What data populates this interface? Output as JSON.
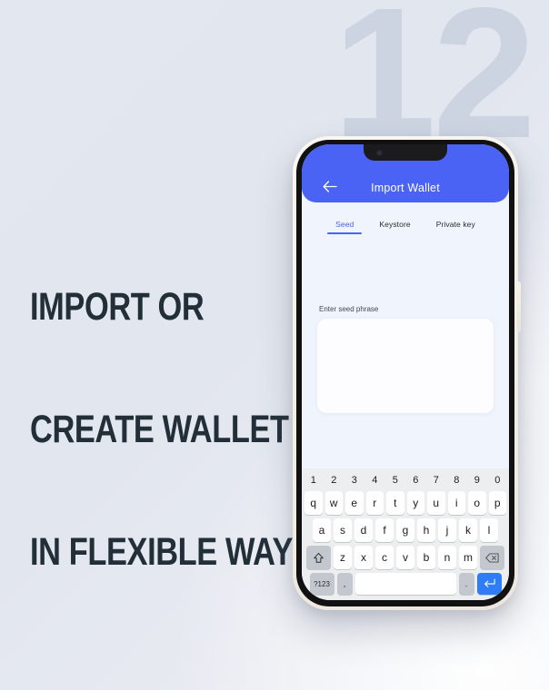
{
  "background": {
    "watermark_number": "12",
    "watermark_color": "#ccd3e0",
    "base_color": "#e2e6ee"
  },
  "headline": {
    "color": "#222e38",
    "lines": [
      "IMPORT OR",
      "CREATE WALLET",
      "IN FLEXIBLE WAYS"
    ]
  },
  "phone": {
    "frame_color": "#f4efe8",
    "bezel_color": "#111111",
    "screen_background": "#eff4fd",
    "side_button": "power-button"
  },
  "app": {
    "accent_color": "#4a63f5",
    "header": {
      "title": "Import Wallet",
      "back_icon": "arrow-left-icon"
    },
    "tabs": [
      {
        "label": "Seed",
        "active": true
      },
      {
        "label": "Keystore",
        "active": false
      },
      {
        "label": "Private key",
        "active": false
      }
    ],
    "form": {
      "seed_label": "Enter seed phrase",
      "seed_value": "",
      "seed_placeholder": ""
    }
  },
  "keyboard": {
    "background": "#eceef0",
    "enter_key_color": "#2f7df6",
    "rows": {
      "numbers": [
        "1",
        "2",
        "3",
        "4",
        "5",
        "6",
        "7",
        "8",
        "9",
        "0"
      ],
      "top": [
        "q",
        "w",
        "e",
        "r",
        "t",
        "y",
        "u",
        "i",
        "o",
        "p"
      ],
      "home": [
        "a",
        "s",
        "d",
        "f",
        "g",
        "h",
        "j",
        "k",
        "l"
      ],
      "bottom": [
        "z",
        "x",
        "c",
        "v",
        "b",
        "n",
        "m"
      ]
    },
    "special": {
      "shift": "shift-icon",
      "backspace": "backspace-icon",
      "symbols": "?123",
      "comma": ",",
      "space": "",
      "period": ".",
      "enter": "enter-icon"
    }
  }
}
